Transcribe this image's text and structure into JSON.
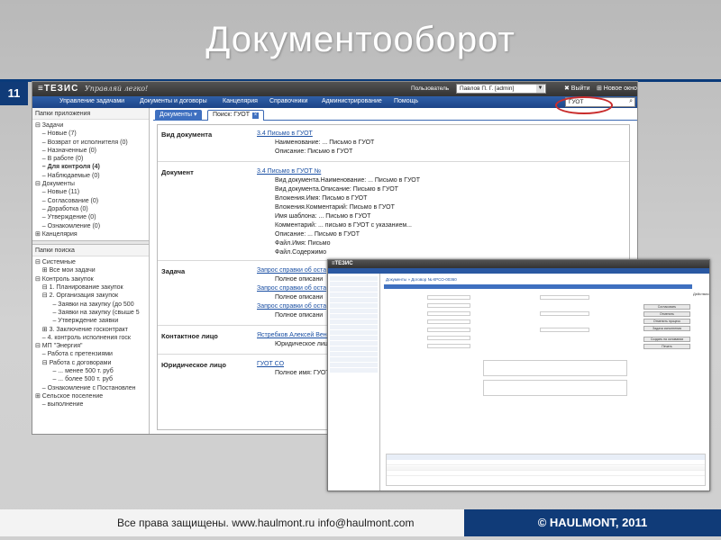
{
  "slide": {
    "title": "Документооборот",
    "number": "11",
    "footer_rights": "Все права защищены. www.haulmont.ru info@haulmont.com",
    "footer_copyright": "© HAULMONT, 2011"
  },
  "app": {
    "logo": "≡ТЕЗИС",
    "slogan": "Управляй легко!",
    "user_label": "Пользователь",
    "user_value": "Павлов П. Г. [admin]",
    "logout": "✖ Выйти",
    "new_window": "⊞ Новое окно",
    "menu": [
      "Управление задачами",
      "Документы и договоры",
      "Канцелярия",
      "Справочники",
      "Администрирование",
      "Помощь"
    ],
    "search_value": "ГУОТ",
    "app_folders_title": "Папки приложения",
    "app_folders": [
      "⊟ Задачи",
      "  – Новые (7)",
      "  – Возврат от исполнителя (0)",
      "  – Назначенные (0)",
      "  – В работе (0)",
      "  – Для контроля (4)",
      "  – Наблюдаемые (0)",
      "⊟ Документы",
      "  – Новые (11)",
      "  – Согласование (0)",
      "  – Доработка (0)",
      "  – Утверждение (0)",
      "  – Ознакомление (0)",
      "⊞ Канцелярия"
    ],
    "search_folders_title": "Папки поиска",
    "search_folders": [
      "⊟ Системные",
      "  ⊞ Все мои задачи",
      "⊟ Контроль закупок",
      "  ⊟ 1. Планирование закупок",
      "  ⊟ 2. Организация закупок",
      "     – Заявки на закупку (до 500",
      "     – Заявки на закупку (свыше 5",
      "     – Утверждение заявки",
      "  ⊞ 3. Заключение госконтракт",
      "  – 4. контроль исполнения госк",
      "⊟ МП \"Энергия\"",
      "  – Работа с претензиями",
      "  ⊟ Работа с договорами",
      "     – ... менее 500 т. руб",
      "     – ... более 500 т. руб",
      "  – Ознакомление с Постановлен",
      "⊞ Сельское поселение",
      "  – выполнение"
    ],
    "tabs": {
      "documents": "Документы",
      "search": "Поиск: ГУОТ"
    },
    "results": {
      "doc_kind_label": "Вид документа",
      "doc_kind_link": "3.4 Письмо в ГУОТ",
      "doc_kind_lines": [
        "Наименование: ... Письмо в ГУОТ",
        "Описание: Письмо в ГУОТ"
      ],
      "document_label": "Документ",
      "document_link": "3.4 Письмо в ГУОТ №",
      "document_lines": [
        "Вид документа.Наименование: ... Письмо в ГУОТ",
        "Вид документа.Описание: Письмо в ГУОТ",
        "Вложения.Имя: Письмо в ГУОТ",
        "Вложения.Комментарий: Письмо в ГУОТ",
        "Имя шаблона: ... Письмо в ГУОТ",
        "Комментарий: ... письмо в ГУОТ с указанием...",
        "Описание: ... Письмо в ГУОТ",
        "Файл.Имя: Письмо",
        "Файл.Содержимо"
      ],
      "task_label": "Задача",
      "task_rows": [
        {
          "link": "Запрос справки об оста",
          "desc": "Полное описани"
        },
        {
          "link": "Запрос справки об оста",
          "desc": "Полное описани"
        },
        {
          "link": "Запрос справки об оста",
          "desc": "Полное описани"
        }
      ],
      "contact_label": "Контактное лицо",
      "contact_link": "Ястребков Алексей Вене",
      "contact_desc": "Юридическое лиц",
      "legal_label": "Юридическое лицо",
      "legal_link": "ГУОТ СО",
      "legal_desc": "Полное имя: ГУОТ"
    }
  },
  "app2": {
    "logo": "≡ТЕЗИС",
    "breadcrumb": "Документы » Договор № КРСО-00360",
    "actions_title": "Действия",
    "buttons": [
      "Согласовать",
      "Отменить",
      "Отменить процесс",
      "Задача исполнения",
      "Создать на основании",
      "Печать"
    ]
  }
}
